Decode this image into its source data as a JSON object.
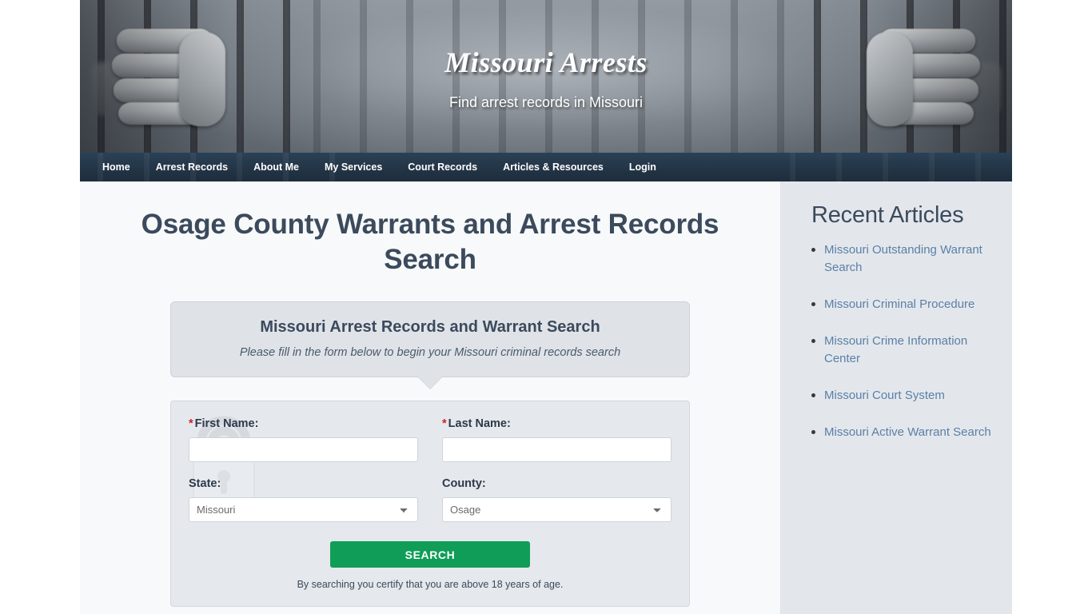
{
  "site": {
    "title": "Missouri Arrests",
    "tagline": "Find arrest records in Missouri"
  },
  "nav": {
    "items": [
      {
        "label": "Home"
      },
      {
        "label": "Arrest Records"
      },
      {
        "label": "About Me"
      },
      {
        "label": "My Services"
      },
      {
        "label": "Court Records"
      },
      {
        "label": "Articles & Resources"
      },
      {
        "label": "Login"
      }
    ]
  },
  "main": {
    "page_title": "Osage County Warrants and Arrest Records Search",
    "callout": {
      "title": "Missouri Arrest Records and Warrant Search",
      "subtitle": "Please fill in the form below to begin your Missouri criminal records search"
    },
    "form": {
      "first_name": {
        "label": "First Name:",
        "required_marker": "*",
        "value": "",
        "placeholder": ""
      },
      "last_name": {
        "label": "Last Name:",
        "required_marker": "*",
        "value": "",
        "placeholder": ""
      },
      "state": {
        "label": "State:",
        "selected": "Missouri",
        "options": [
          "Missouri"
        ]
      },
      "county": {
        "label": "County:",
        "selected": "Osage",
        "options": [
          "Osage"
        ]
      },
      "submit_label": "SEARCH",
      "certify_text": "By searching you certify that you are above 18 years of age.",
      "watermark_icon": "padlock-icon"
    }
  },
  "sidebar": {
    "title": "Recent Articles",
    "items": [
      {
        "label": "Missouri Outstanding Warrant Search"
      },
      {
        "label": "Missouri Criminal Procedure"
      },
      {
        "label": "Missouri Crime Information Center"
      },
      {
        "label": "Missouri Court System"
      },
      {
        "label": "Missouri Active Warrant Search"
      }
    ]
  },
  "colors": {
    "nav_bg": "#233546",
    "heading": "#3b4a5c",
    "link": "#5b7fa6",
    "button": "#0f9d58",
    "required": "#cc2127",
    "sidebar_bg": "#e3e7ec",
    "panel_bg": "#e5e8ec"
  }
}
